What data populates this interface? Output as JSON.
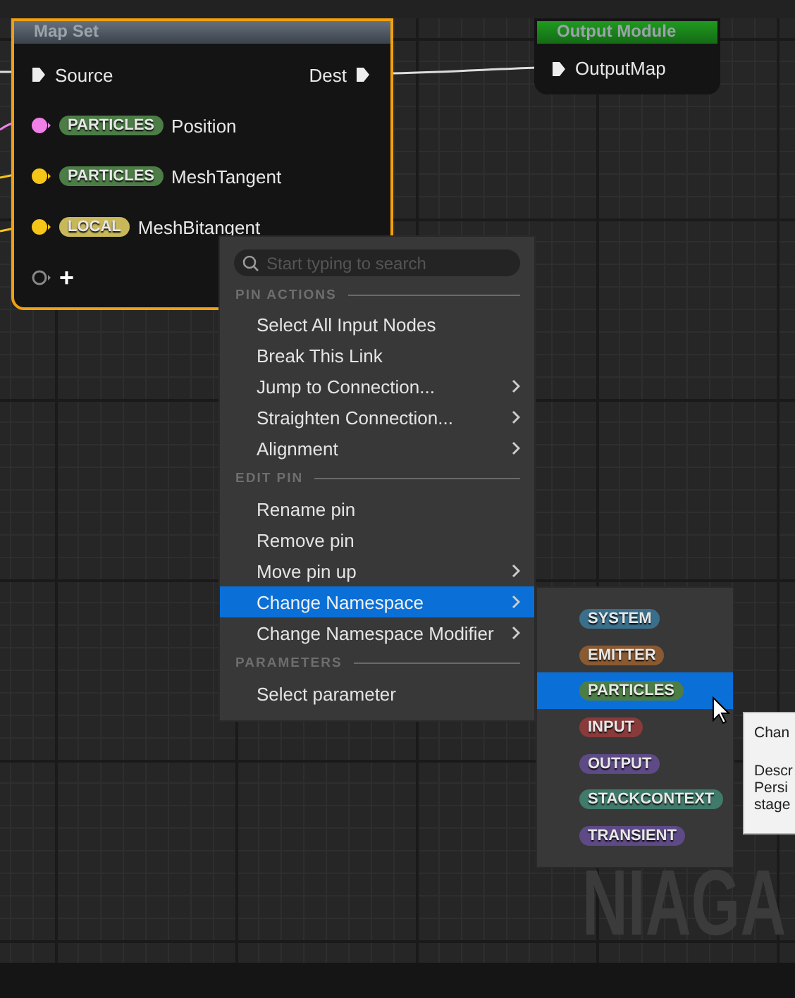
{
  "map_set_node": {
    "title": "Map Set",
    "selected": true,
    "pins": [
      {
        "kind": "exec",
        "label": "Source",
        "output_label": "Dest"
      },
      {
        "kind": "data",
        "color": "#f080e8",
        "namespace": {
          "label": "PARTICLES",
          "color": "#4c7d46"
        },
        "label": "Position"
      },
      {
        "kind": "data",
        "color": "#f5c518",
        "namespace": {
          "label": "PARTICLES",
          "color": "#4c7d46"
        },
        "label": "MeshTangent"
      },
      {
        "kind": "data",
        "color": "#f5c518",
        "namespace": {
          "label": "LOCAL",
          "color": "#c9b85a"
        },
        "label": "MeshBitangent"
      },
      {
        "kind": "add",
        "label": "+"
      }
    ]
  },
  "output_node": {
    "title": "Output Module",
    "pin": "OutputMap"
  },
  "context_menu": {
    "search": {
      "placeholder": "Start typing to search"
    },
    "sections": [
      {
        "heading": "PIN ACTIONS",
        "items": [
          {
            "label": "Select All Input Nodes",
            "submenu": false,
            "selected": false
          },
          {
            "label": "Break This Link",
            "submenu": false,
            "selected": false
          },
          {
            "label": "Jump to Connection...",
            "submenu": true,
            "selected": false
          },
          {
            "label": "Straighten Connection...",
            "submenu": true,
            "selected": false
          },
          {
            "label": "Alignment",
            "submenu": true,
            "selected": false
          }
        ]
      },
      {
        "heading": "EDIT PIN",
        "items": [
          {
            "label": "Rename pin",
            "submenu": false,
            "selected": false
          },
          {
            "label": "Remove pin",
            "submenu": false,
            "selected": false
          },
          {
            "label": "Move pin up",
            "submenu": true,
            "selected": false
          },
          {
            "label": "Change Namespace",
            "submenu": true,
            "selected": true
          },
          {
            "label": "Change Namespace Modifier",
            "submenu": true,
            "selected": false
          }
        ]
      },
      {
        "heading": "PARAMETERS",
        "items": [
          {
            "label": "Select parameter",
            "submenu": false,
            "selected": false
          }
        ]
      }
    ]
  },
  "namespace_menu": [
    {
      "label": "SYSTEM",
      "color": "#3a6f8c",
      "selected": false
    },
    {
      "label": "EMITTER",
      "color": "#8a5a32",
      "selected": false
    },
    {
      "label": "PARTICLES",
      "color": "#4c7d46",
      "selected": true
    },
    {
      "label": "INPUT",
      "color": "#8a3a3a",
      "selected": false
    },
    {
      "label": "OUTPUT",
      "color": "#5e4a86",
      "selected": false
    },
    {
      "label": "STACKCONTEXT",
      "color": "#3f7a6a",
      "selected": false
    },
    {
      "label": "TRANSIENT",
      "color": "#5e4a86",
      "selected": false
    }
  ],
  "tooltip": {
    "title": "Chan",
    "lines": [
      "Descr",
      "Persi",
      "stage"
    ]
  },
  "graph_label": "NIAGA"
}
